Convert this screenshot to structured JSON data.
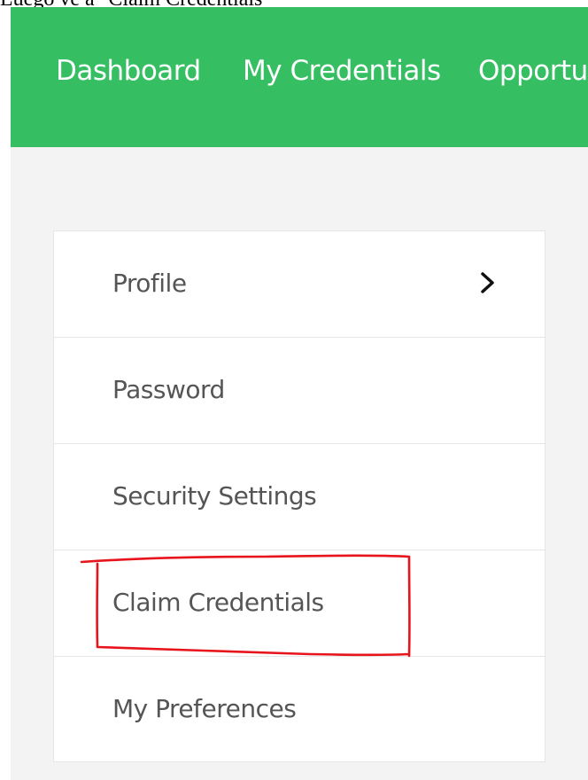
{
  "caption": "Luego ve a \"Claim Credentials\"",
  "topnav": {
    "background": "#36bf62",
    "links": [
      {
        "label": "Dashboard"
      },
      {
        "label": "My Credentials"
      },
      {
        "label": "Opportu"
      }
    ]
  },
  "menu": {
    "items": [
      {
        "label": "Profile",
        "icon": "chevron-right-icon"
      },
      {
        "label": "Password"
      },
      {
        "label": "Security Settings"
      },
      {
        "label": "Claim Credentials",
        "highlighted": true
      },
      {
        "label": "My Preferences"
      }
    ]
  },
  "annotation": {
    "color": "#e8141c",
    "target": "Claim Credentials"
  }
}
